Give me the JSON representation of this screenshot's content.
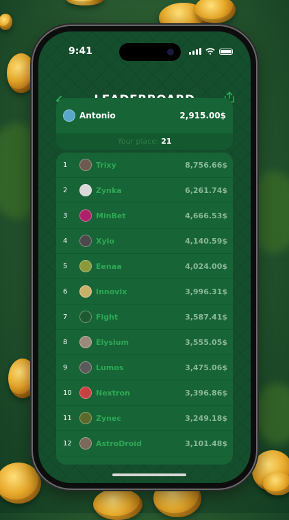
{
  "status_bar": {
    "time": "9:41"
  },
  "header": {
    "title": "LEADERBOARD",
    "back_icon": "arrow-left-icon",
    "share_icon": "share-icon"
  },
  "me": {
    "name": "Antonio",
    "score": "2,915.00$",
    "place_label": "Your place:",
    "place": "21",
    "avatar_color": "#58a6c9"
  },
  "leaderboard": [
    {
      "rank": "1",
      "name": "Trixy",
      "score": "8,756.66$",
      "avatar_color": "#6a5a4f"
    },
    {
      "rank": "2",
      "name": "Zynka",
      "score": "6,261.74$",
      "avatar_color": "#d9d9d9"
    },
    {
      "rank": "3",
      "name": "MinBet",
      "score": "4,666.53$",
      "avatar_color": "#b0206a"
    },
    {
      "rank": "4",
      "name": "Xylo",
      "score": "4,140.59$",
      "avatar_color": "#4a4a4a"
    },
    {
      "rank": "5",
      "name": "Eenaa",
      "score": "4,024.00$",
      "avatar_color": "#8a9a3a"
    },
    {
      "rank": "6",
      "name": "Innovix",
      "score": "3,996.31$",
      "avatar_color": "#c9b06a"
    },
    {
      "rank": "7",
      "name": "Fight",
      "score": "3,587.41$",
      "avatar_color": "#1e5a30"
    },
    {
      "rank": "8",
      "name": "Elysium",
      "score": "3,555.05$",
      "avatar_color": "#9a8a7a"
    },
    {
      "rank": "9",
      "name": "Lumos",
      "score": "3,475.06$",
      "avatar_color": "#5a5a5a"
    },
    {
      "rank": "10",
      "name": "Nextron",
      "score": "3,396.86$",
      "avatar_color": "#c84040"
    },
    {
      "rank": "11",
      "name": "Zynec",
      "score": "3,249.18$",
      "avatar_color": "#5a6a2a"
    },
    {
      "rank": "12",
      "name": "AstroDroid",
      "score": "3,101.48$",
      "avatar_color": "#7a6a5a"
    }
  ],
  "colors": {
    "screen_bg": "#0f4a28",
    "card_bg": "#176436",
    "accent": "#2fa857"
  }
}
